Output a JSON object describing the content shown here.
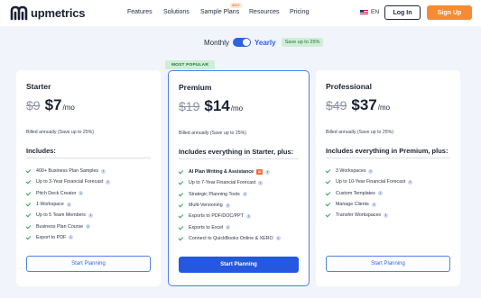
{
  "nav": {
    "brand": "upmetrics",
    "links": [
      "Features",
      "Solutions",
      "Sample Plans",
      "Resources",
      "Pricing"
    ],
    "sample_plans_badge": "400+",
    "language": "EN",
    "login_label": "Log In",
    "signup_label": "Sign Up"
  },
  "billing": {
    "monthly_label": "Monthly",
    "yearly_label": "Yearly",
    "selected": "Yearly",
    "save_label": "Save up to 25%"
  },
  "popular_tag": "MOST POPULAR",
  "plans": [
    {
      "name": "Starter",
      "old_price": "$9",
      "new_price": "$7",
      "per": "/mo",
      "billed": "Billed annually (Save up to 25%)",
      "includes": "Includes:",
      "features": [
        "400+ Business Plan Samples",
        "Up to 3-Year Financial Forecast",
        "Pitch Deck Creator",
        "1 Workspace",
        "Up to 5 Team Members",
        "Business Plan Course",
        "Export to PDF"
      ],
      "cta": "Start Planning"
    },
    {
      "name": "Premium",
      "old_price": "$19",
      "new_price": "$14",
      "per": "/mo",
      "billed": "Billed annually (Save up to 25%)",
      "includes": "Includes everything in Starter, plus:",
      "features": [
        "AI Plan Writing & Assistance",
        "Up to 7-Year Financial Forecast",
        "Strategic Planning Tools",
        "Multi-Versioning",
        "Exports to PDF/DOC/PPT",
        "Exports to Excel",
        "Connect to QuickBooks Online & XERO"
      ],
      "ai_badge": "AI",
      "cta": "Start Planning"
    },
    {
      "name": "Professional",
      "old_price": "$49",
      "new_price": "$37",
      "per": "/mo",
      "billed": "Billed annually (Save up to 25%)",
      "includes": "Includes everything in Premium, plus:",
      "features": [
        "3 Workspaces",
        "Up to 10-Year Financial Forecast",
        "Custom Templates",
        "Manage Clients",
        "Transfer Workspaces"
      ],
      "cta": "Start Planning"
    }
  ],
  "colors": {
    "accent": "#2f62e0",
    "signup": "#f78b33",
    "check": "#2fa35a",
    "page_bg": "#f1f5fb"
  }
}
